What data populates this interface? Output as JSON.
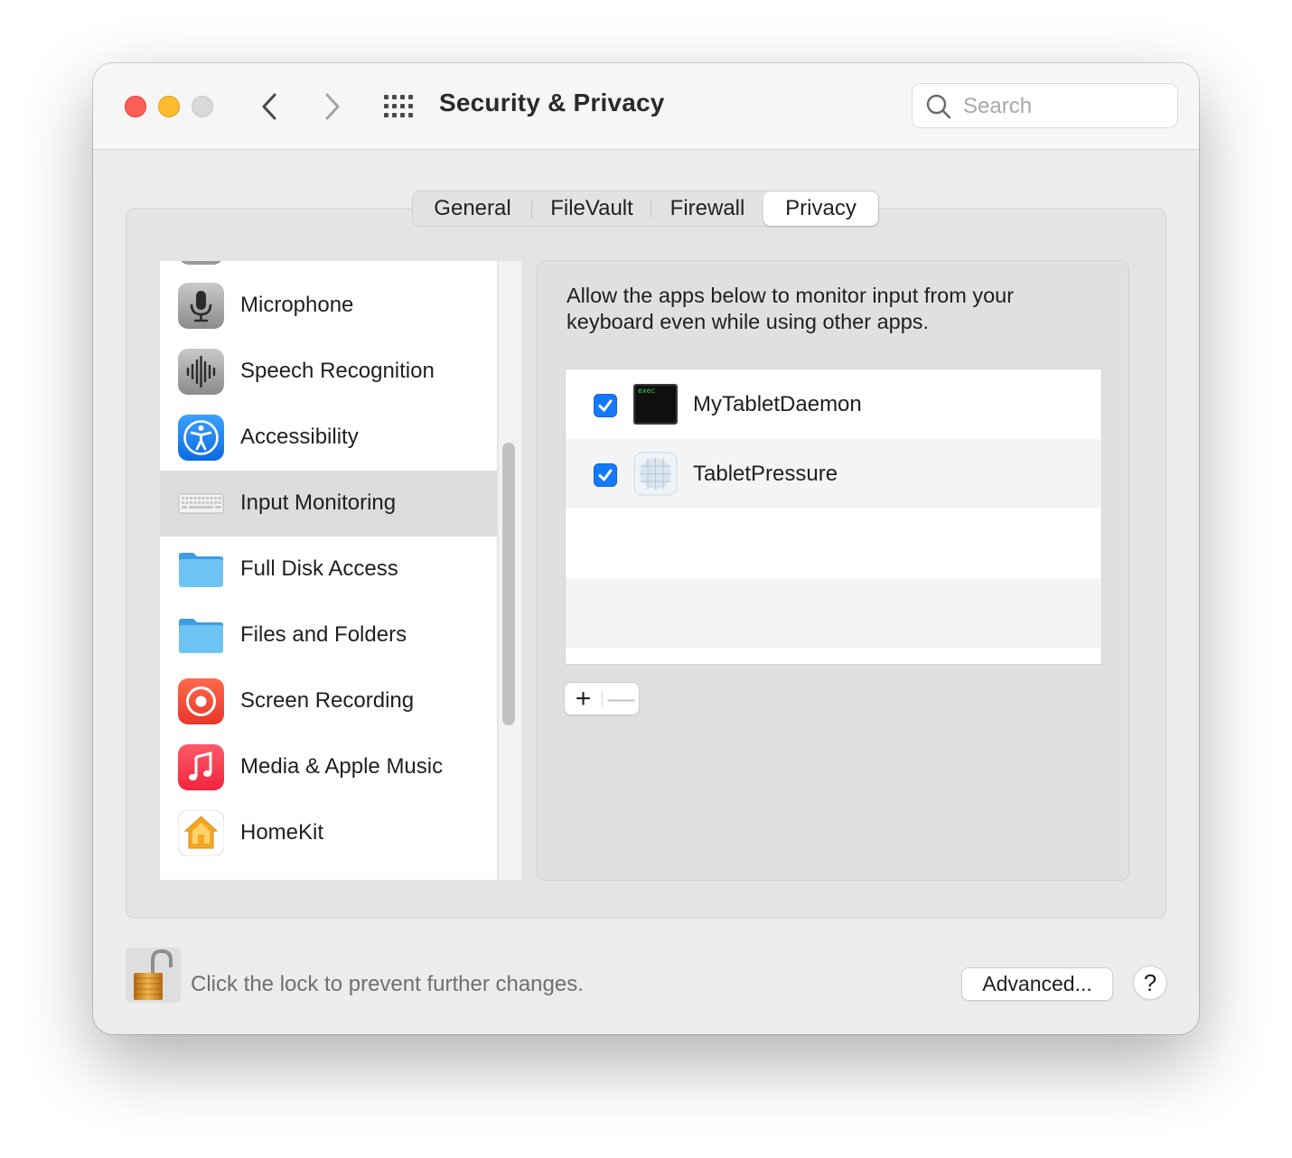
{
  "window": {
    "title": "Security & Privacy"
  },
  "search": {
    "placeholder": "Search"
  },
  "tabs": [
    {
      "label": "General",
      "selected": false
    },
    {
      "label": "FileVault",
      "selected": false
    },
    {
      "label": "Firewall",
      "selected": false
    },
    {
      "label": "Privacy",
      "selected": true
    }
  ],
  "sidebar": {
    "items": [
      {
        "label": "Microphone",
        "icon": "microphone-icon"
      },
      {
        "label": "Speech Recognition",
        "icon": "waveform-icon"
      },
      {
        "label": "Accessibility",
        "icon": "accessibility-icon"
      },
      {
        "label": "Input Monitoring",
        "icon": "keyboard-icon",
        "selected": true
      },
      {
        "label": "Full Disk Access",
        "icon": "folder-icon"
      },
      {
        "label": "Files and Folders",
        "icon": "folder-icon"
      },
      {
        "label": "Screen Recording",
        "icon": "screen-recording-icon"
      },
      {
        "label": "Media & Apple Music",
        "icon": "music-note-icon"
      },
      {
        "label": "HomeKit",
        "icon": "home-icon"
      }
    ]
  },
  "main": {
    "description": "Allow the apps below to monitor input from your keyboard even while using other apps.",
    "apps": [
      {
        "name": "MyTabletDaemon",
        "checked": true,
        "icon": "terminal-exec-icon",
        "icon_text": "exec"
      },
      {
        "name": "TabletPressure",
        "checked": true,
        "icon": "generic-app-icon"
      }
    ],
    "add_label": "+",
    "remove_label": "—"
  },
  "footer": {
    "lock_text": "Click the lock to prevent further changes.",
    "advanced_label": "Advanced...",
    "help_label": "?"
  },
  "colors": {
    "accent": "#1479fb",
    "close": "#fe5f57",
    "minimize": "#febc2e",
    "zoom": "#d9d9d9"
  }
}
